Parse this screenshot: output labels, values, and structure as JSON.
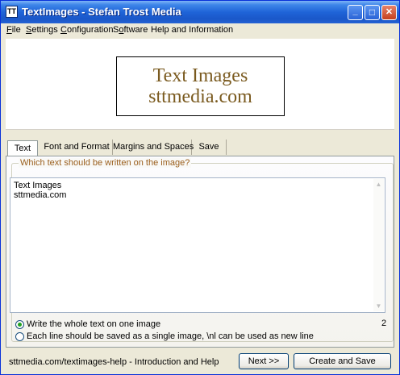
{
  "window": {
    "title": "TextImages - Stefan Trost Media",
    "icon": "TT",
    "controls": {
      "minimize": "_",
      "maximize": "□",
      "close": "✕"
    }
  },
  "menu": {
    "items": [
      {
        "pre": "",
        "key": "F",
        "post": "ile"
      },
      {
        "pre": "",
        "key": "S",
        "post": "ettings"
      },
      {
        "pre": "",
        "key": "C",
        "post": "onfiguration"
      },
      {
        "pre": "S",
        "key": "o",
        "post": "ftware"
      },
      {
        "pre": "Help and Information",
        "key": "",
        "post": ""
      }
    ]
  },
  "preview": {
    "lines": [
      "Text Images",
      "sttmedia.com"
    ],
    "text_color": "#7a5a1f"
  },
  "tabs": [
    {
      "label": "Text",
      "active": true
    },
    {
      "label": "Font and Format",
      "active": false
    },
    {
      "label": "Margins and Spaces",
      "active": false
    },
    {
      "label": "Save",
      "active": false
    }
  ],
  "text_tab": {
    "group_label": "Which text should be written on the image?",
    "lines": [
      "Text Images",
      "sttmedia.com"
    ],
    "line_count": "2",
    "options": [
      {
        "label": "Write the whole text on one image",
        "checked": true
      },
      {
        "label": "Each line should be saved as a single image, \\nl can be used as new line",
        "checked": false
      }
    ]
  },
  "footer": {
    "help_text": "sttmedia.com/textimages-help - Introduction and Help",
    "next_label": "Next >>",
    "create_label": "Create and Save"
  },
  "colors": {
    "titlebar": "#1f64d8",
    "group_label": "#9a5e1c",
    "radio_dot": "#21a121"
  }
}
